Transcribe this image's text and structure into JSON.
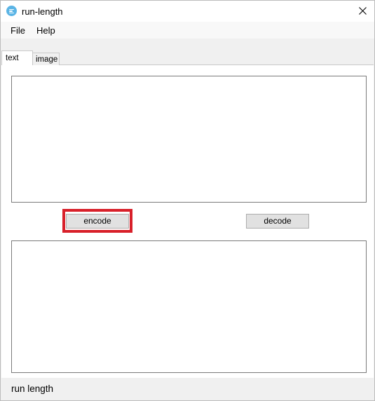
{
  "window": {
    "title": "run-length",
    "app_icon": "run-length-app-icon",
    "close_icon": "close-icon"
  },
  "menu": {
    "items": [
      "File",
      "Help"
    ]
  },
  "tabs": [
    {
      "label": "text",
      "selected": true
    },
    {
      "label": "image",
      "selected": false
    }
  ],
  "text_tab": {
    "input_value": "",
    "output_value": "",
    "encode_label": "encode",
    "decode_label": "decode",
    "highlight_color": "#d8202a"
  },
  "status": {
    "text": "run length"
  }
}
